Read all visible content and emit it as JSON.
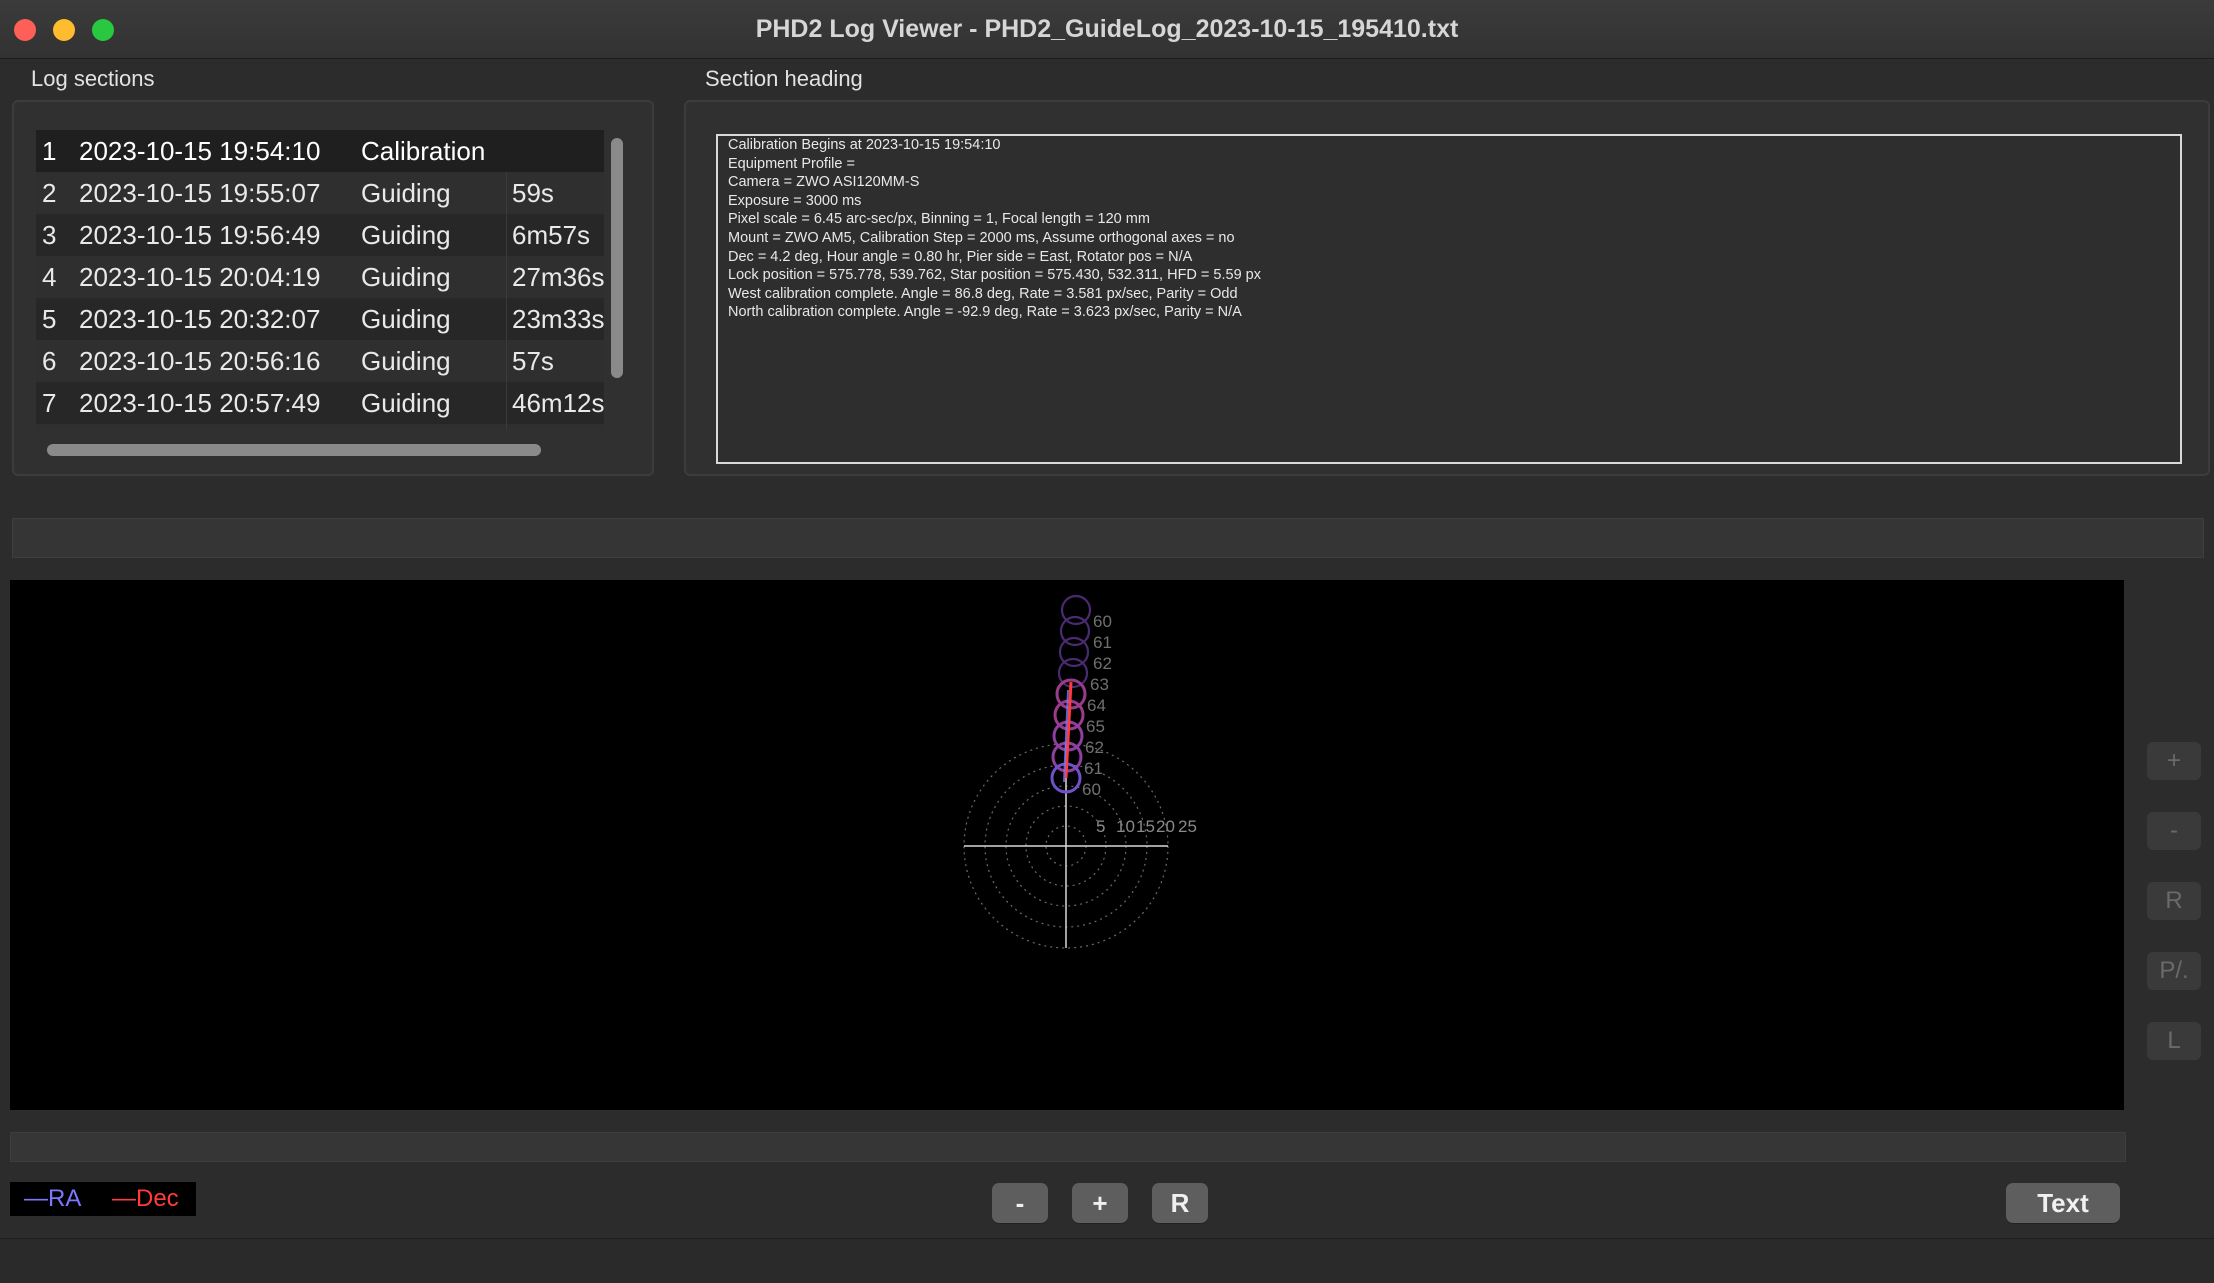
{
  "window": {
    "title": "PHD2 Log Viewer - PHD2_GuideLog_2023-10-15_195410.txt"
  },
  "log_sections": {
    "label": "Log sections",
    "rows": [
      {
        "num": "1",
        "datetime": "2023-10-15 19:54:10",
        "type": "Calibration",
        "duration": "",
        "selected": true
      },
      {
        "num": "2",
        "datetime": "2023-10-15 19:55:07",
        "type": "Guiding",
        "duration": "59s"
      },
      {
        "num": "3",
        "datetime": "2023-10-15 19:56:49",
        "type": "Guiding",
        "duration": "6m57s"
      },
      {
        "num": "4",
        "datetime": "2023-10-15 20:04:19",
        "type": "Guiding",
        "duration": "27m36s"
      },
      {
        "num": "5",
        "datetime": "2023-10-15 20:32:07",
        "type": "Guiding",
        "duration": "23m33s"
      },
      {
        "num": "6",
        "datetime": "2023-10-15 20:56:16",
        "type": "Guiding",
        "duration": "57s"
      },
      {
        "num": "7",
        "datetime": "2023-10-15 20:57:49",
        "type": "Guiding",
        "duration": "46m12s"
      }
    ]
  },
  "section_heading": {
    "label": "Section heading",
    "lines": [
      "Calibration Begins at 2023-10-15 19:54:10",
      "Equipment Profile =",
      "Camera = ZWO ASI120MM-S",
      "Exposure = 3000 ms",
      "Pixel scale = 6.45 arc-sec/px, Binning = 1, Focal length = 120 mm",
      "Mount = ZWO AM5, Calibration Step = 2000 ms, Assume orthogonal axes = no",
      "Dec = 4.2 deg, Hour angle = 0.80 hr, Pier side = East, Rotator pos = N/A",
      "Lock position = 575.778, 539.762, Star position = 575.430, 532.311, HFD = 5.59 px",
      "West calibration complete. Angle = 86.8 deg, Rate = 3.581 px/sec, Parity = Odd",
      "North calibration complete. Angle = -92.9 deg, Rate = 3.623 px/sec, Parity = N/A"
    ]
  },
  "plot": {
    "ring_labels": [
      "5",
      "10",
      "15",
      "20",
      "25"
    ],
    "step_labels": [
      "60",
      "61",
      "62",
      "63",
      "64",
      "65",
      "62",
      "61",
      "60"
    ],
    "colors": {
      "ra": "#7b78ff",
      "dec": "#ff3b3b"
    }
  },
  "side_buttons": {
    "zoom_in": "+",
    "zoom_out": "-",
    "reset": "R",
    "pa": "P/.",
    "l": "L"
  },
  "legend": {
    "ra": "—RA",
    "dec": "—Dec"
  },
  "toolbar": {
    "minus": "-",
    "plus": "+",
    "reset": "R",
    "text": "Text"
  }
}
